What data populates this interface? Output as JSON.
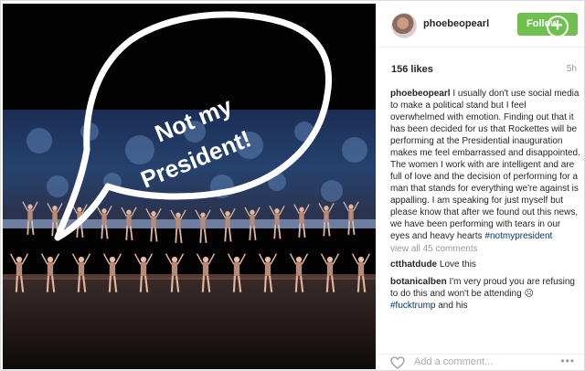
{
  "photo": {
    "caption_overlay_line1": "Not my",
    "caption_overlay_line2": "President!"
  },
  "header": {
    "username": "phoebeopearl",
    "follow_label": "Follow"
  },
  "stats": {
    "likes": "156 likes",
    "time": "5h"
  },
  "caption": {
    "username": "phoebeopearl",
    "text": "I usually don't use social media to make a political stand but I feel overwhelmed with emotion. Finding out that it has been decided for us that Rockettes will be performing at the Presidential inauguration makes me feel embarrassed and disappointed. The women I work with are intelligent and are full of love and the decision of performing for a man that stands for everything we're against is appalling. I am speaking for just myself but please know that after we found out this news, we have been performing with tears in our eyes and heavy hearts",
    "hashtag": "#notmypresident"
  },
  "view_all": "view all 45 comments",
  "comments": [
    {
      "username": "ctthatdude",
      "text": "Love this"
    },
    {
      "username": "botanicalben",
      "text": "I'm very proud you are refusing to do this and won't be attending",
      "emoji": "☹",
      "hashtag": "#fucktrump",
      "tail": "and his"
    }
  ],
  "footer": {
    "add_comment_placeholder": "Add a comment...",
    "more": "•••"
  }
}
